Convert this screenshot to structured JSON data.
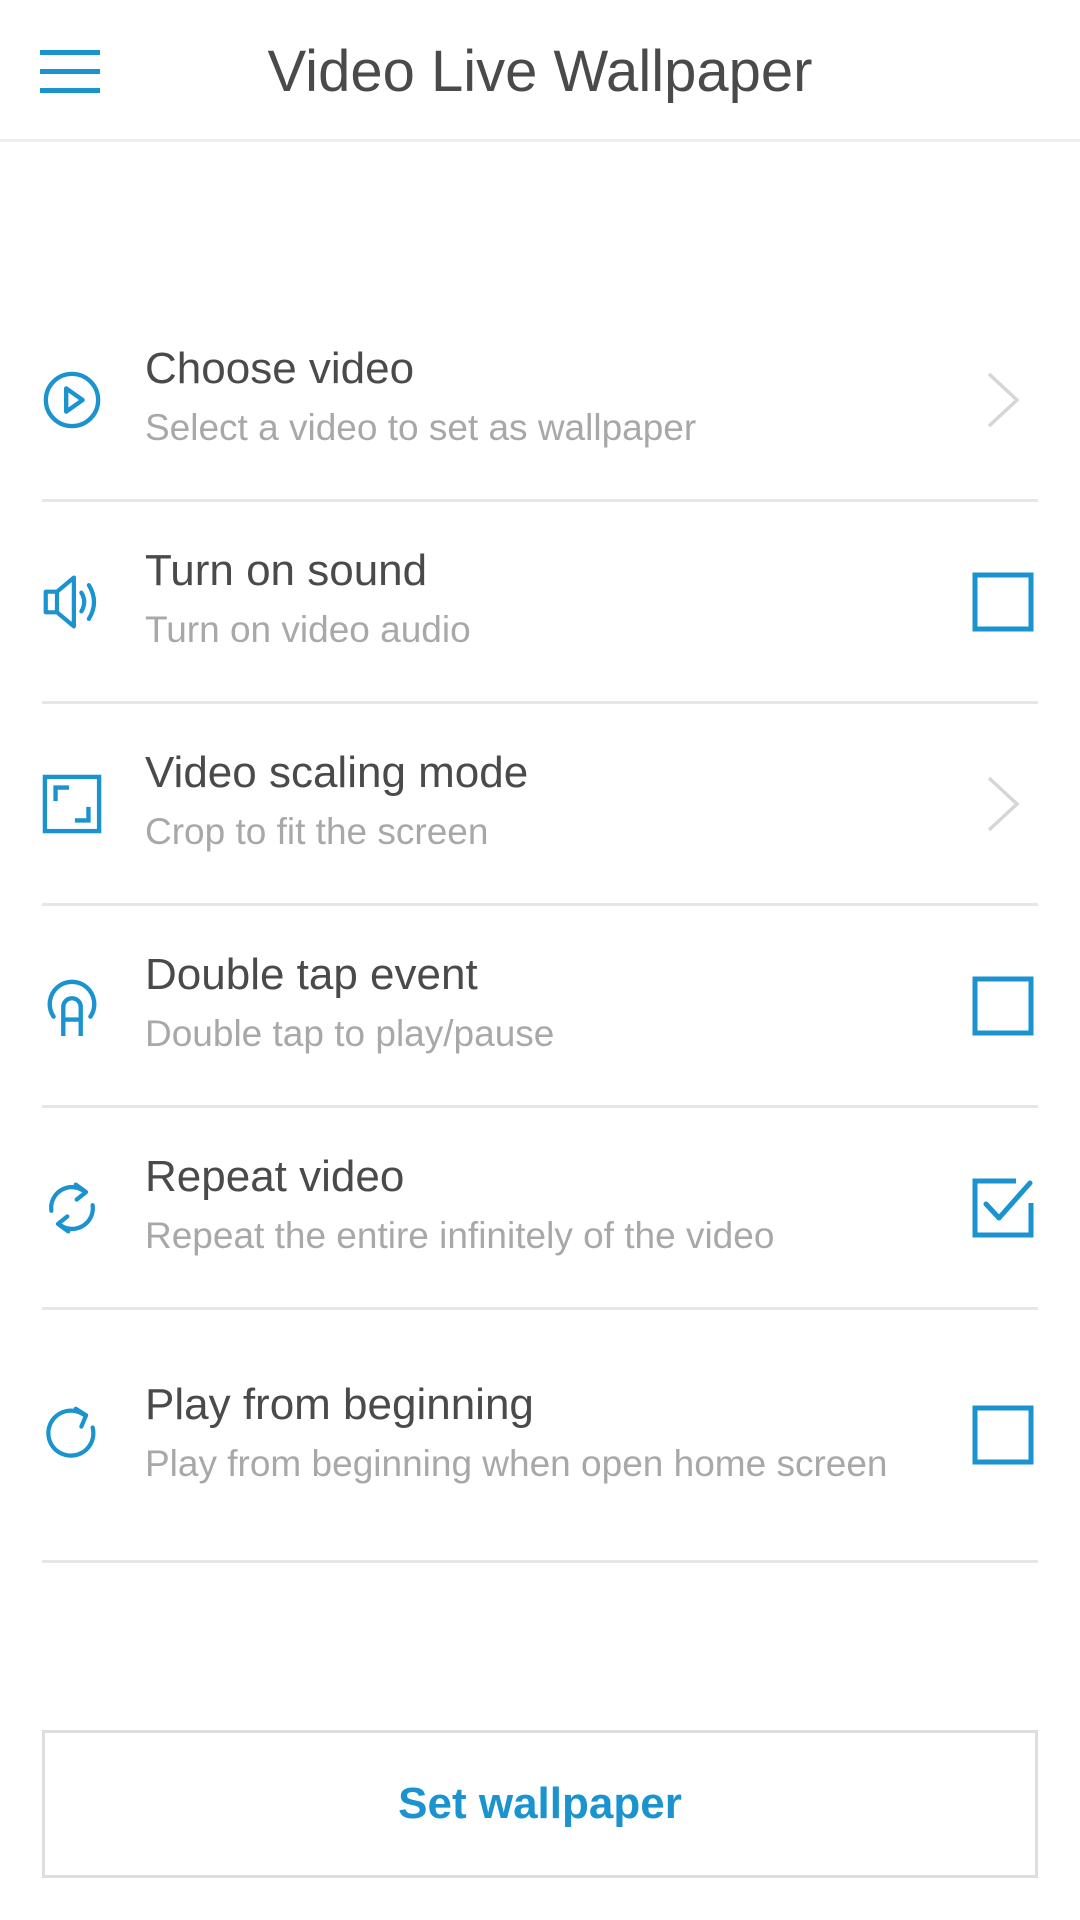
{
  "colors": {
    "accent": "#1a93cf",
    "title_text": "#4a4a4a",
    "subtitle_text": "#a8a8a8",
    "divider": "#e6e6e6",
    "chevron": "#d6d6d6"
  },
  "appbar": {
    "menu_icon": "hamburger-menu-icon",
    "title": "Video Live Wallpaper"
  },
  "settings": {
    "items": [
      {
        "icon": "play-circle-icon",
        "title": "Choose video",
        "subtitle": "Select a video to set as wallpaper",
        "control": "chevron"
      },
      {
        "icon": "speaker-icon",
        "title": "Turn on sound",
        "subtitle": "Turn on video audio",
        "control": "checkbox",
        "checked": false
      },
      {
        "icon": "scaling-frame-icon",
        "title": "Video scaling mode",
        "subtitle": "Crop to fit the screen",
        "control": "chevron"
      },
      {
        "icon": "double-tap-icon",
        "title": "Double tap event",
        "subtitle": "Double tap to play/pause",
        "control": "checkbox",
        "checked": false
      },
      {
        "icon": "repeat-icon",
        "title": "Repeat video",
        "subtitle": "Repeat the entire infinitely of the video",
        "control": "checkbox",
        "checked": true
      },
      {
        "icon": "replay-icon",
        "title": "Play from beginning",
        "subtitle": "Play from beginning when open home screen",
        "control": "checkbox",
        "checked": false
      }
    ]
  },
  "footer": {
    "set_wallpaper_label": "Set wallpaper"
  }
}
